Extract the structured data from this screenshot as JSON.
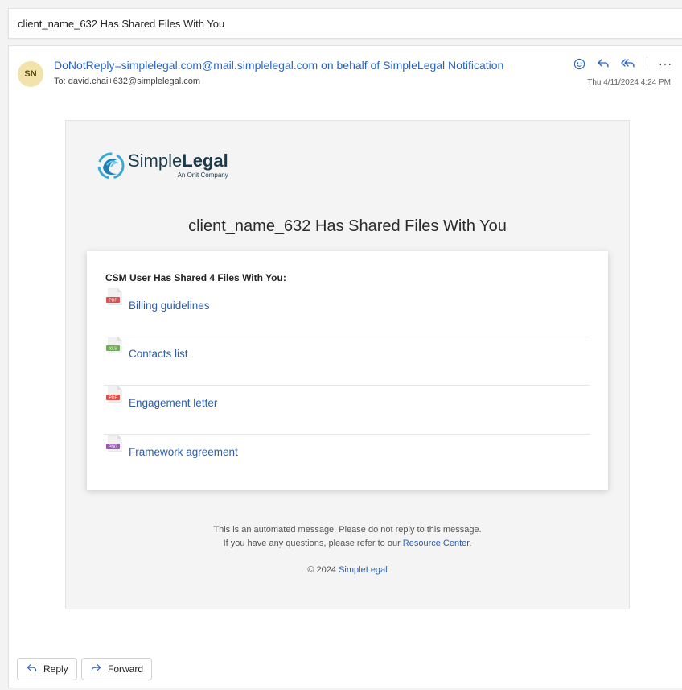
{
  "subject": "client_name_632 Has Shared Files With You",
  "message": {
    "avatar_initials": "SN",
    "sender": "DoNotReply=simplelegal.com@mail.simplelegal.com on behalf of SimpleLegal Notification",
    "to": "To: david.chai+632@simplelegal.com",
    "date": "Thu 4/11/2024 4:24 PM",
    "actions": {
      "emoji": "☺",
      "reply": "↶",
      "reply_all": "↶↶",
      "more": "···"
    }
  },
  "email": {
    "logo": {
      "simple": "Simple",
      "legal": "Legal",
      "tagline": "An Onit Company"
    },
    "headline": "client_name_632 Has Shared Files With You",
    "files_title": "CSM User Has Shared 4 Files With You:",
    "files": [
      {
        "name": "Billing guidelines",
        "type": "PDF",
        "color": "#d9534f"
      },
      {
        "name": "Contacts list",
        "type": "XLS",
        "color": "#6ab04c"
      },
      {
        "name": "Engagement letter",
        "type": "PDF",
        "color": "#d9534f"
      },
      {
        "name": "Framework agreement",
        "type": "PNG",
        "color": "#9b59b6"
      }
    ],
    "footer": {
      "line1": "This is an automated message. Please do not reply to this message.",
      "line2_prefix": "If you have any questions, please refer to our",
      "line2_link": "Resource Center",
      "line2_suffix": ".",
      "copyright_prefix": "© 2024",
      "copyright_link": "SimpleLegal"
    }
  },
  "buttons": {
    "reply": "Reply",
    "forward": "Forward"
  },
  "colors": {
    "accent": "#2564cf",
    "link": "#2a5db0",
    "avatar_bg": "#f2e2ac"
  },
  "icons": {
    "reply": "reply-arrow-icon",
    "forward": "forward-arrow-icon",
    "emoji": "smiley-icon",
    "more": "more-icon",
    "logo": "simplelegal-swirl-icon"
  }
}
